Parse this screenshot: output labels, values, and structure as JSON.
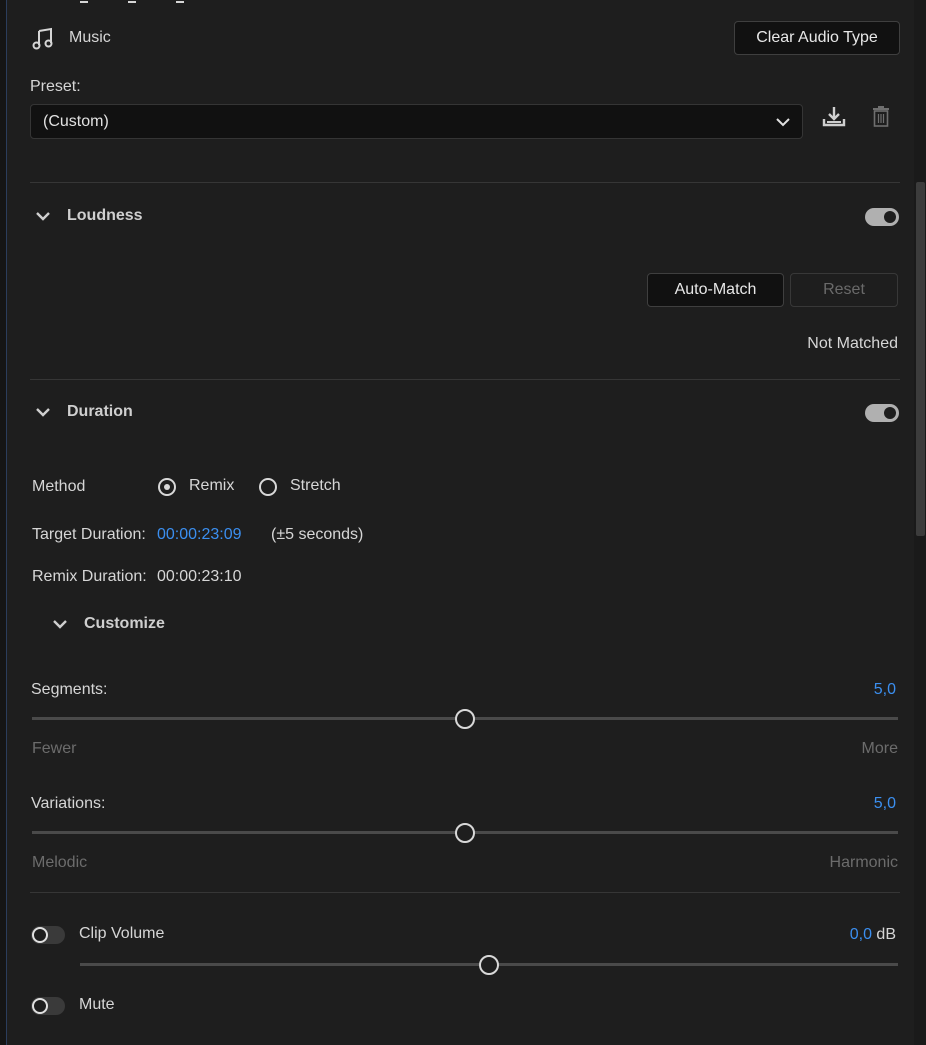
{
  "audio_type": {
    "name": "Music",
    "clear_button": "Clear Audio Type"
  },
  "preset": {
    "label": "Preset:",
    "value": "(Custom)"
  },
  "loudness": {
    "title": "Loudness",
    "enabled": true,
    "auto_match": "Auto-Match",
    "reset": "Reset",
    "status": "Not Matched"
  },
  "duration": {
    "title": "Duration",
    "enabled": true,
    "method_label": "Method",
    "method_options": [
      "Remix",
      "Stretch"
    ],
    "method_selected": "Remix",
    "target_label": "Target Duration:",
    "target_value": "00:00:23:09",
    "target_tolerance": "(±5 seconds)",
    "remix_label": "Remix Duration:",
    "remix_value": "00:00:23:10",
    "customize": "Customize",
    "segments": {
      "label": "Segments:",
      "value": "5,0",
      "level": 0.5,
      "min_label": "Fewer",
      "max_label": "More"
    },
    "variations": {
      "label": "Variations:",
      "value": "5,0",
      "level": 0.5,
      "min_label": "Melodic",
      "max_label": "Harmonic"
    }
  },
  "clip_volume": {
    "label": "Clip Volume",
    "enabled": false,
    "value": "0,0",
    "unit": "dB",
    "level": 0.5
  },
  "mute": {
    "label": "Mute",
    "enabled": false
  },
  "icons": [
    "music-note-icon",
    "save-preset-icon",
    "delete-preset-icon",
    "chevron-down-icon"
  ]
}
